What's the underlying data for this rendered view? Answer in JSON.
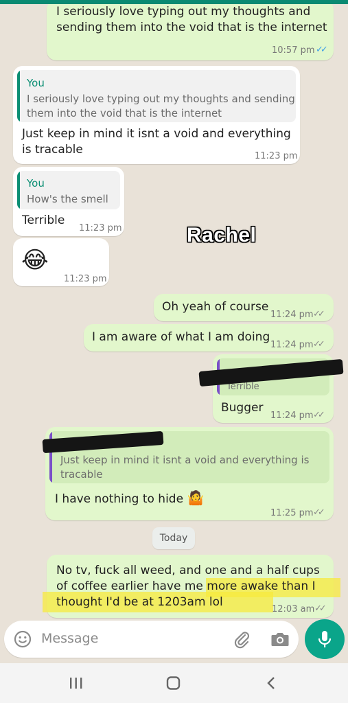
{
  "messages": {
    "m1": {
      "text_line1": "I seriously love typing out my thoughts and",
      "text_line2": "sending them into the void that is the internet",
      "time": "10:57 pm"
    },
    "m2": {
      "quote_name": "You",
      "quote_line1": "I seriously love typing out my thoughts and sending",
      "quote_line2": "them into the void that is the internet",
      "text_line1": "Just keep in mind it isnt a void and everything",
      "text_line2": "is tracable",
      "time": "11:23 pm"
    },
    "m3": {
      "quote_name": "You",
      "quote_text": "How's the smell",
      "text": "Terrible",
      "time": "11:23 pm"
    },
    "m4": {
      "emoji": "😂",
      "time": "11:23 pm"
    },
    "m5": {
      "text": "Oh yeah of course",
      "time": "11:24 pm"
    },
    "m6": {
      "text": "I am aware of what I am doing",
      "time": "11:24 pm"
    },
    "m7": {
      "quote_text": "Terrible",
      "text": "Bugger",
      "time": "11:24 pm"
    },
    "m8": {
      "quote_line1": "Just keep in mind it isnt a void and everything is",
      "quote_line2": "tracable",
      "text": "I have nothing to hide",
      "emoji": "🤷",
      "time": "11:25 pm"
    },
    "m9": {
      "text_line1": "No tv, fuck all weed, and one and a half cups",
      "text_line2": "of coffee earlier have me more awake than I",
      "text_line3": "thought I'd be at 1203am lol",
      "time": "12:03 am"
    }
  },
  "overlay_label": "Rachel",
  "date_divider": "Today",
  "input": {
    "placeholder": "Message"
  },
  "icons": {
    "emoji": "emoji-icon",
    "attach": "paperclip-icon",
    "camera": "camera-icon",
    "mic": "microphone-icon",
    "nav_recent": "recent-apps-icon",
    "nav_home": "home-icon",
    "nav_back": "back-icon"
  },
  "colors": {
    "accent": "#0aa58a",
    "outgoing_bubble": "#e2f7cc",
    "incoming_bubble": "#ffffff",
    "read_ticks": "#3b9de8",
    "highlight": "#f7ea3e"
  }
}
